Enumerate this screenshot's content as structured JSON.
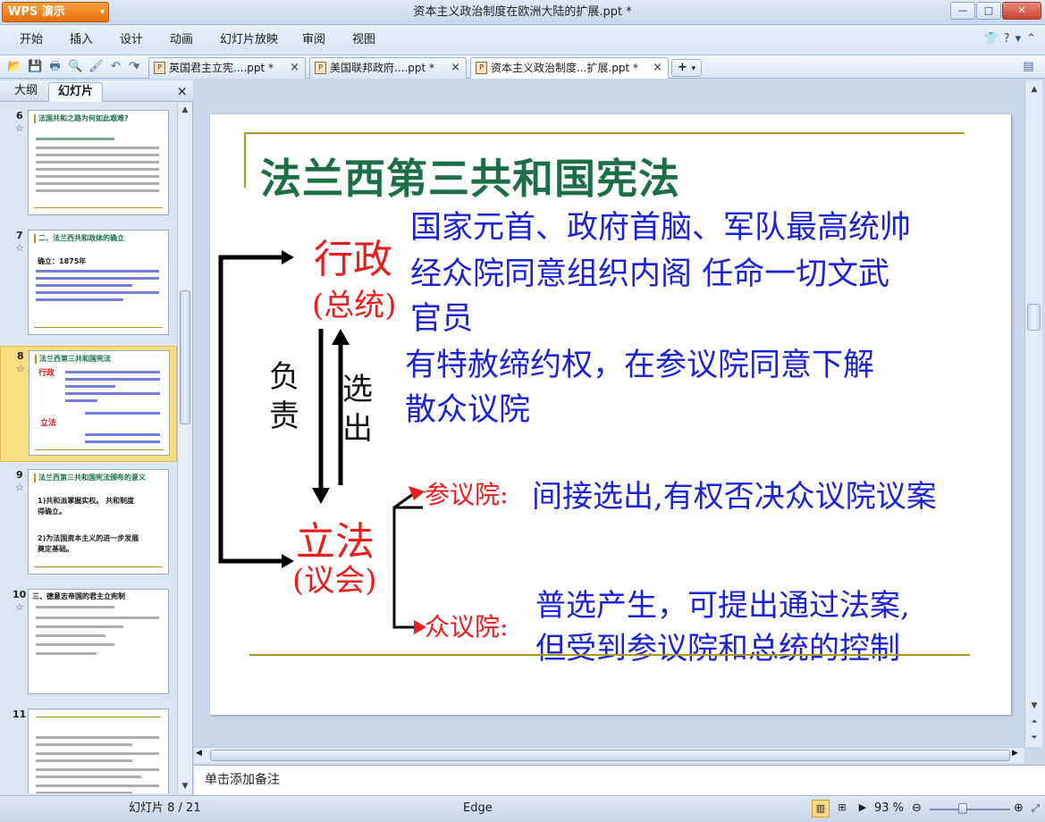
{
  "app": {
    "logo": "WPS 演示",
    "window_title": "资本主义政治制度在欧洲大陆的扩展.ppt *",
    "win_min": "—",
    "win_max": "□",
    "win_close": "✕"
  },
  "menu": {
    "items": [
      "开始",
      "插入",
      "设计",
      "动画",
      "幻灯片放映",
      "审阅",
      "视图"
    ],
    "help": "?"
  },
  "tabs": [
    {
      "label": "英国君主立宪....ppt *",
      "active": false
    },
    {
      "label": "美国联邦政府....ppt *",
      "active": false
    },
    {
      "label": "资本主义政治制度...扩展.ppt *",
      "active": true
    }
  ],
  "tab_add": "+",
  "panel": {
    "tab_outline": "大纲",
    "tab_slides": "幻灯片",
    "close": "×"
  },
  "thumbnails": [
    {
      "num": "6",
      "title": "法国共和之路为何如此艰难?",
      "selected": false
    },
    {
      "num": "7",
      "title": "二、法兰西共和政体的确立",
      "body": "确立：1875年",
      "selected": false
    },
    {
      "num": "8",
      "title": "法兰西第三共和国宪法",
      "selected": true
    },
    {
      "num": "9",
      "title": "法兰西第三共和国宪法颁布的意义",
      "body1": "1)共和派掌握实权。 共和制度",
      "body2": "得确立。",
      "body3": "2)为法国资本主义的进一步发展",
      "body4": "奠定基础。",
      "selected": false
    },
    {
      "num": "10",
      "title": "三、德意志帝国的君主立宪制",
      "selected": false
    },
    {
      "num": "11",
      "title": "",
      "selected": false
    }
  ],
  "slide": {
    "title": "法兰西第三共和国宪法",
    "exec_label": "行政",
    "exec_sub": "(总统)",
    "exec_line1": "国家元首、政府首脑、军队最高统帅",
    "exec_line2": "经众院同意组织内阁 任命一切文武",
    "exec_line3": "官员",
    "exec_line4": "有特赦缔约权，在参议院同意下解",
    "exec_line5": "散众议院",
    "resp": [
      "负",
      "责"
    ],
    "elect": [
      "选",
      "出"
    ],
    "leg_label": "立法",
    "leg_sub": "(议会)",
    "senate_label": "参议院:",
    "senate_text": "间接选出,有权否决众议院议案",
    "deputies_label": "众议院:",
    "deputies_line1": "普选产生，可提出通过法案,",
    "deputies_line2": "但受到参议院和总统的控制"
  },
  "notes_placeholder": "单击添加备注",
  "status": {
    "slide_counter": "幻灯片 8 / 21",
    "theme": "Edge",
    "zoom": "93 %",
    "zoom_level": 0.93
  },
  "colors": {
    "title_green": "#1c6e45",
    "text_blue": "#1a23d6",
    "label_red": "#ee1b1b",
    "gold_rule": "#b19620",
    "selected_thumb": "#f7dd82"
  }
}
